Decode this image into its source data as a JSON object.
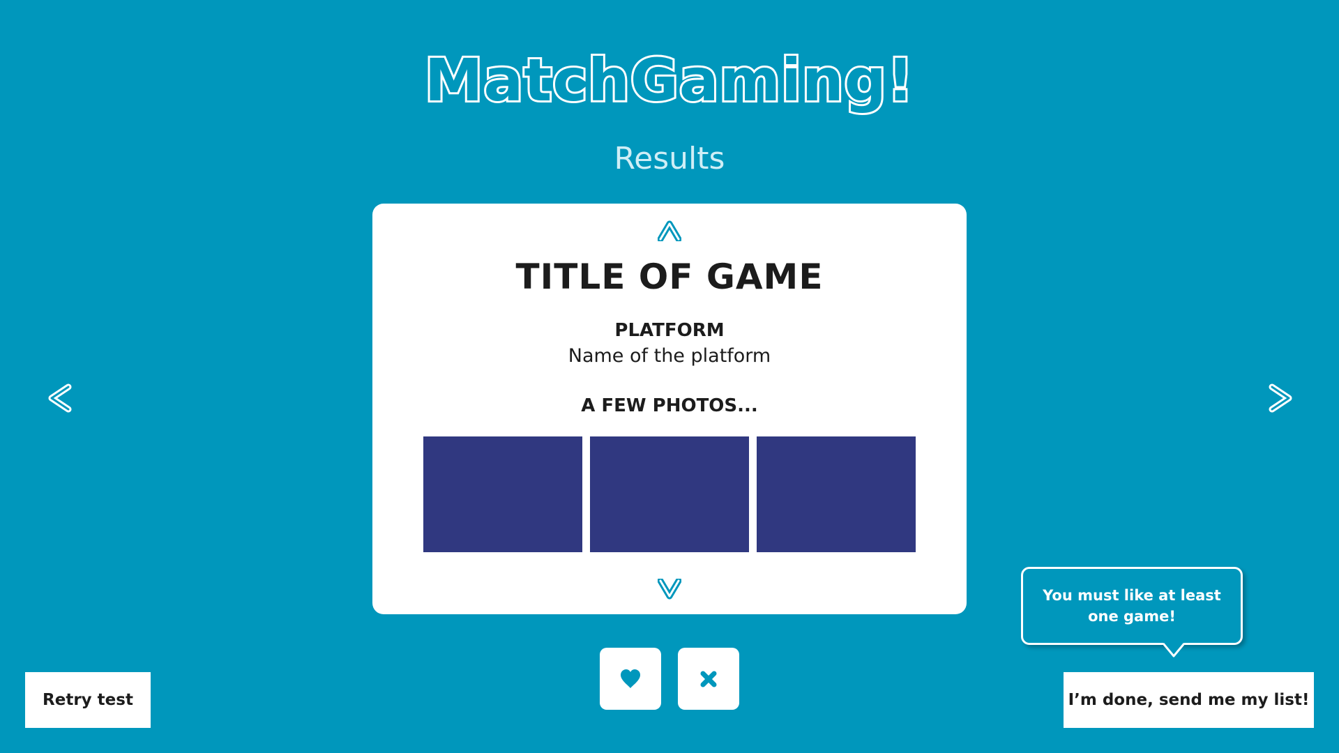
{
  "app": {
    "title": "MatchGaming!",
    "subtitle": "Results"
  },
  "card": {
    "title": "TITLE OF GAME",
    "platform_label": "PLATFORM",
    "platform_value": "Name of the platform",
    "photos_label": "A FEW PHOTOS..."
  },
  "icons": {
    "scroll_up": "chevron-up-icon",
    "scroll_down": "chevron-down-icon",
    "previous": "chevron-left-icon",
    "next": "chevron-right-icon",
    "like": "heart-icon",
    "dislike": "close-icon"
  },
  "tooltip": {
    "text": "You must like at least one game!"
  },
  "buttons": {
    "retry_label": "Retry test",
    "done_label": "I’m done, send me my list!"
  },
  "colors": {
    "background": "#0097bc",
    "card": "#ffffff",
    "photo_placeholder": "#303880",
    "text": "#1c1c1c",
    "accent": "#0097bc"
  }
}
